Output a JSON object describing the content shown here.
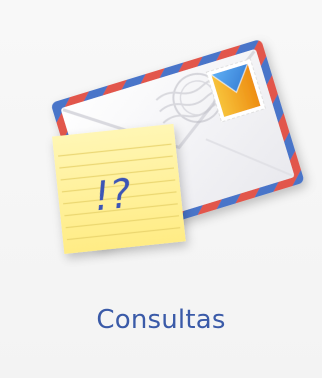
{
  "tile": {
    "label": "Consultas",
    "icon": "envelope-with-sticky-note-icon",
    "sticky_note_text": "!?"
  },
  "colors": {
    "label": "#3a5aa8",
    "envelope_border_red": "#e2574c",
    "envelope_border_blue": "#4a74c9",
    "sticky_note": "#fff09a",
    "sticky_note_ink": "#3b55b5",
    "stamp_blue": "#2f7fd8",
    "stamp_orange": "#f3a51d",
    "background": "#f5f5f5"
  }
}
